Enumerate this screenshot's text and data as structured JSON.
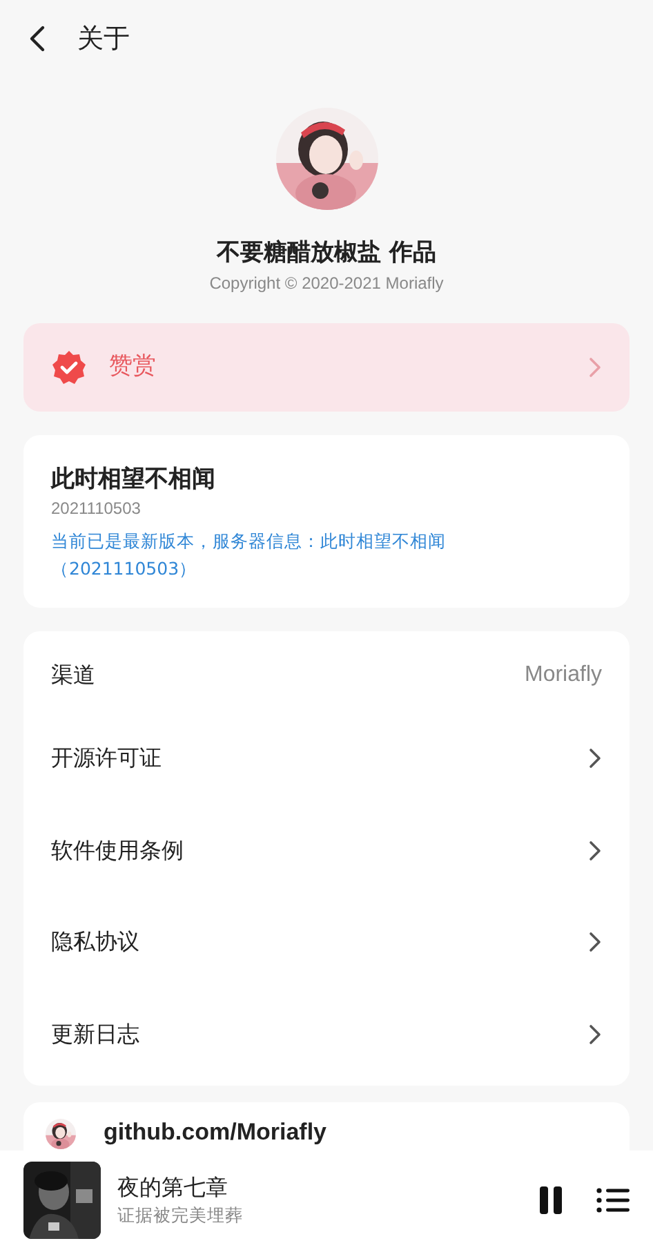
{
  "header": {
    "title": "关于"
  },
  "profile": {
    "author": "不要糖醋放椒盐 作品",
    "copyright": "Copyright © 2020-2021 Moriafly"
  },
  "reward": {
    "label": "赞赏"
  },
  "version": {
    "name": "此时相望不相闻",
    "code": "2021110503",
    "status": "当前已是最新版本，服务器信息：此时相望不相闻（2021110503）"
  },
  "settings": [
    {
      "kind": "value",
      "label": "渠道",
      "value": "Moriafly"
    },
    {
      "kind": "link",
      "label": "开源许可证"
    },
    {
      "kind": "link",
      "label": "软件使用条例"
    },
    {
      "kind": "link",
      "label": "隐私协议"
    },
    {
      "kind": "link",
      "label": "更新日志"
    }
  ],
  "github": {
    "label": "github.com/Moriafly"
  },
  "player": {
    "title": "夜的第七章",
    "subtitle": "证据被完美埋葬",
    "playing": true
  }
}
